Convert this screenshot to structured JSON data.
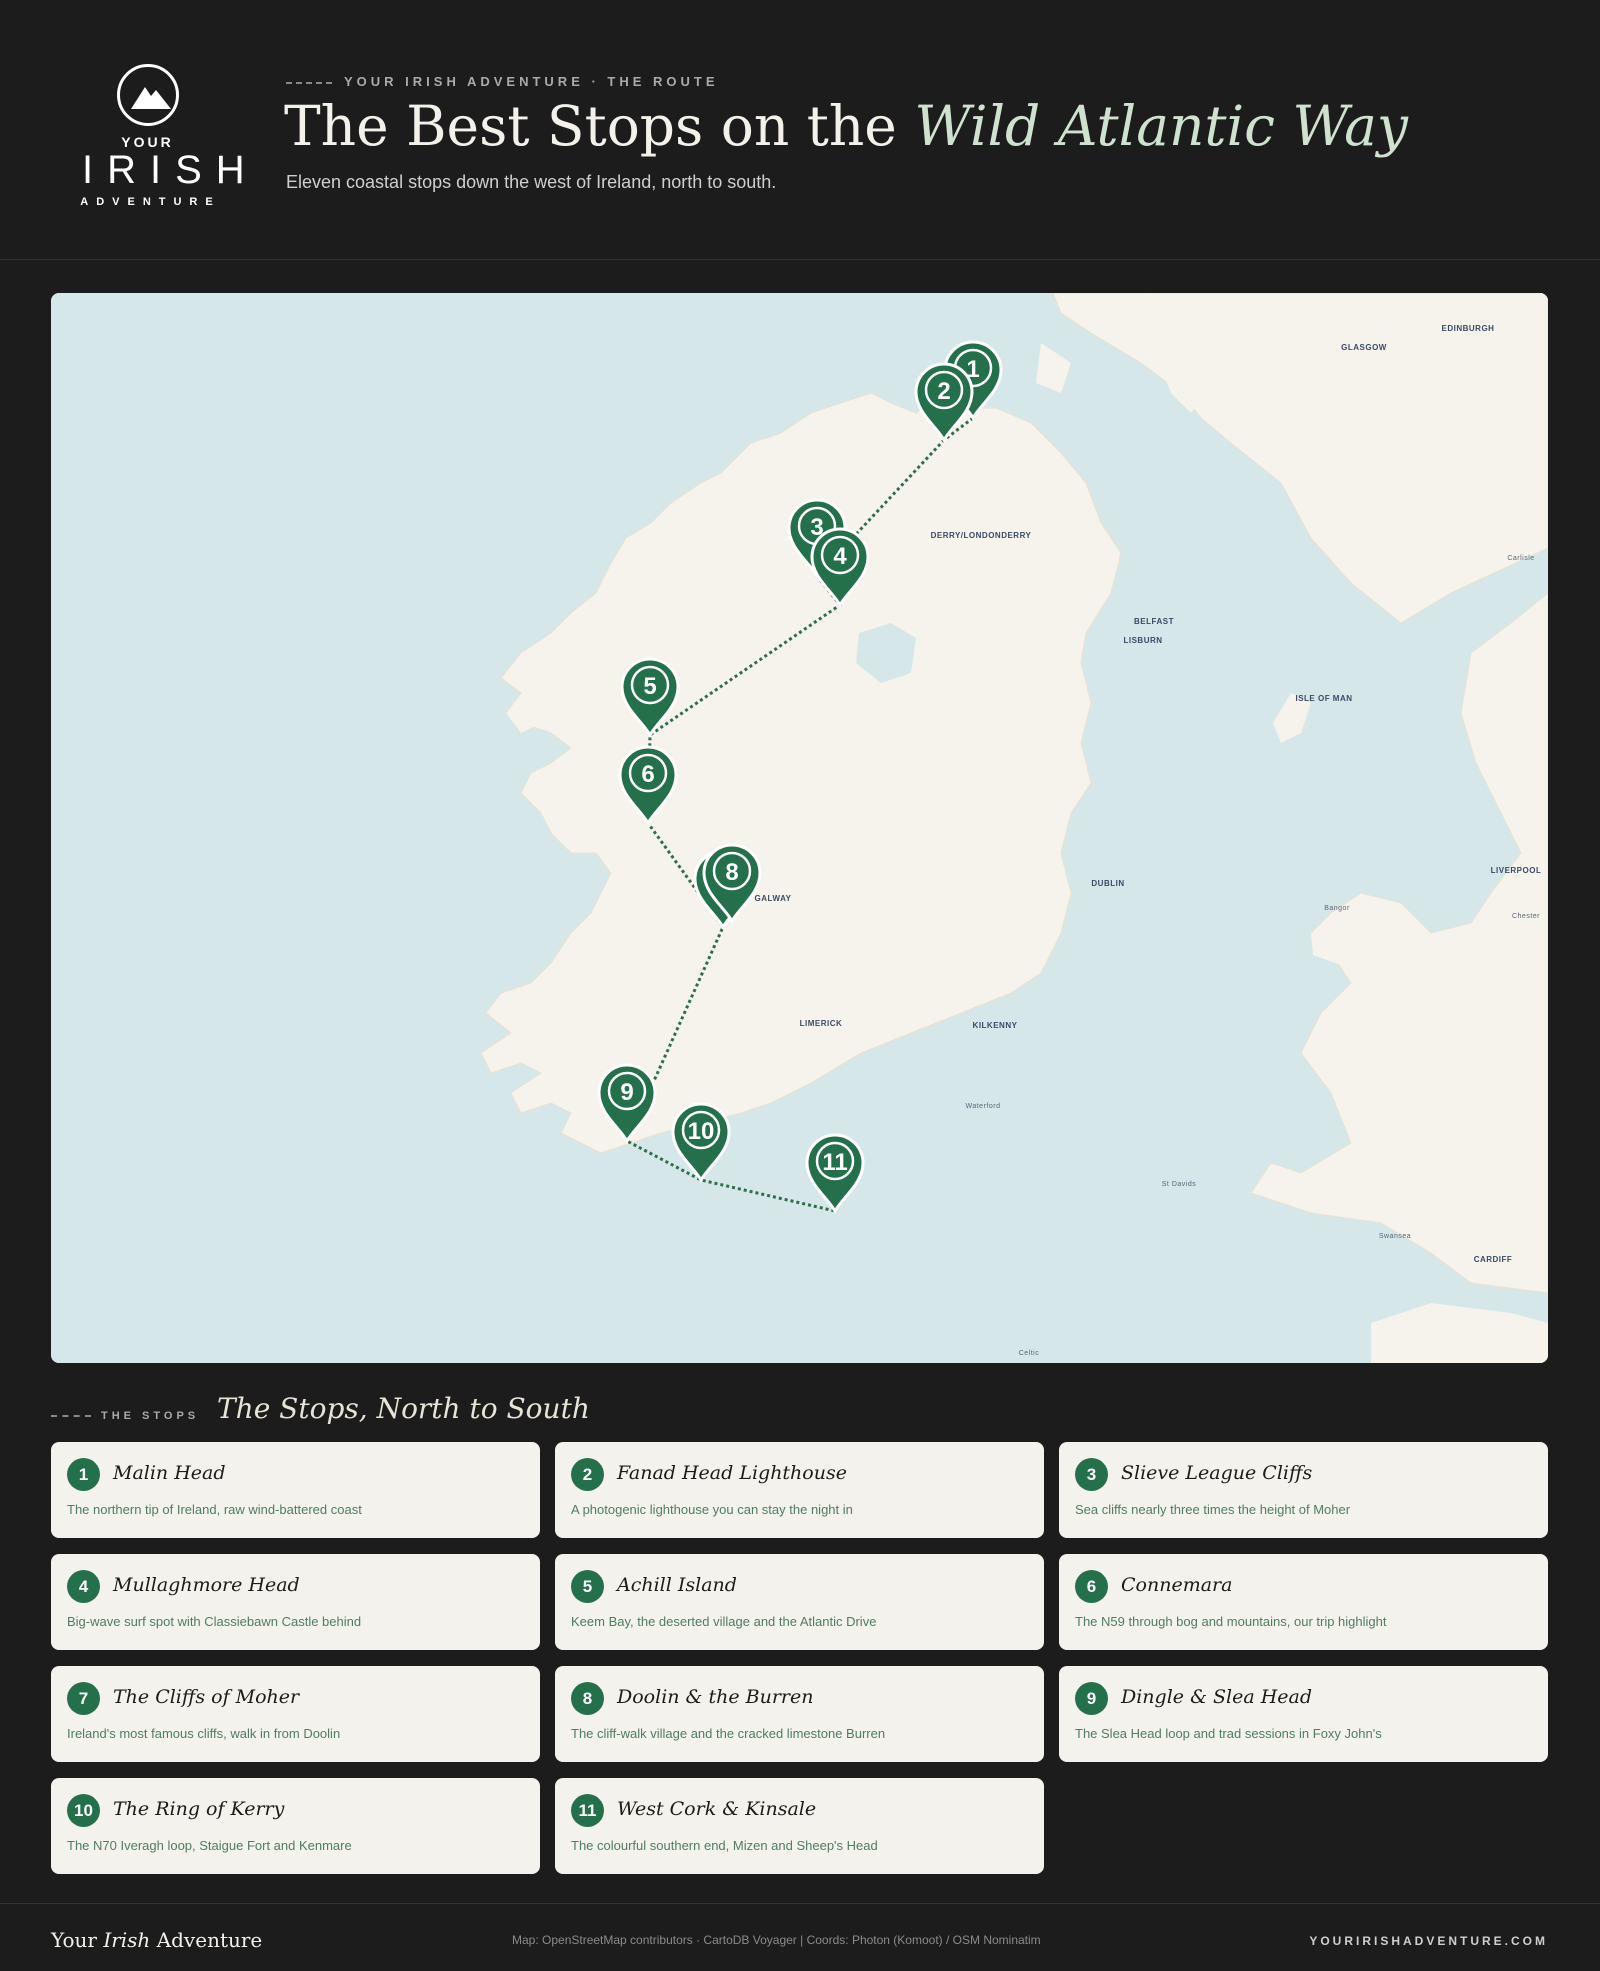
{
  "logo": {
    "top": "YOUR",
    "main": "IRISH",
    "bottom": "ADVENTURE"
  },
  "header": {
    "kicker": "YOUR IRISH ADVENTURE · THE ROUTE",
    "title_main": "The Best Stops on the ",
    "title_accent": "Wild Atlantic Way",
    "subtitle": "Eleven coastal stops down the west of Ireland, north to south."
  },
  "map": {
    "labels": [
      "EDINBURGH",
      "GLASGOW",
      "DERRY/LONDONDERRY",
      "BELFAST",
      "LISBURN",
      "Carlisle",
      "ISLE OF MAN",
      "DUBLIN",
      "Bangor",
      "LIVERPOOL",
      "Chester",
      "LIMERICK",
      "KILKENNY",
      "Waterford",
      "St Davids",
      "Swansea",
      "CARDIFF",
      "GALWAY",
      "Celtic"
    ],
    "colors": {
      "sea": "#d6e7ea",
      "land": "#f5f3ec",
      "marker": "#23704a",
      "route": "#2f6e47"
    }
  },
  "stops_section": {
    "kicker": "THE STOPS",
    "title": "The Stops, North to South"
  },
  "stops": [
    {
      "num": "1",
      "name": "Malin Head",
      "desc": "The northern tip of Ireland, raw wind-battered coast"
    },
    {
      "num": "2",
      "name": "Fanad Head Lighthouse",
      "desc": "A photogenic lighthouse you can stay the night in"
    },
    {
      "num": "3",
      "name": "Slieve League Cliffs",
      "desc": "Sea cliffs nearly three times the height of Moher"
    },
    {
      "num": "4",
      "name": "Mullaghmore Head",
      "desc": "Big-wave surf spot with Classiebawn Castle behind"
    },
    {
      "num": "5",
      "name": "Achill Island",
      "desc": "Keem Bay, the deserted village and the Atlantic Drive"
    },
    {
      "num": "6",
      "name": "Connemara",
      "desc": "The N59 through bog and mountains, our trip highlight"
    },
    {
      "num": "7",
      "name": "The Cliffs of Moher",
      "desc": "Ireland's most famous cliffs, walk in from Doolin"
    },
    {
      "num": "8",
      "name": "Doolin & the Burren",
      "desc": "The cliff-walk village and the cracked limestone Burren"
    },
    {
      "num": "9",
      "name": "Dingle & Slea Head",
      "desc": "The Slea Head loop and trad sessions in Foxy John's"
    },
    {
      "num": "10",
      "name": "The Ring of Kerry",
      "desc": "The N70 Iveragh loop, Staigue Fort and Kenmare"
    },
    {
      "num": "11",
      "name": "West Cork & Kinsale",
      "desc": "The colourful southern end, Mizen and Sheep's Head"
    }
  ],
  "footer": {
    "brand_a": "Your ",
    "brand_b": "Irish",
    "brand_c": " Adventure",
    "credits": "Map: OpenStreetMap contributors · CartoDB Voyager | Coords: Photon (Komoot) / OSM Nominatim",
    "site": "YOURIRISHADVENTURE.COM"
  }
}
